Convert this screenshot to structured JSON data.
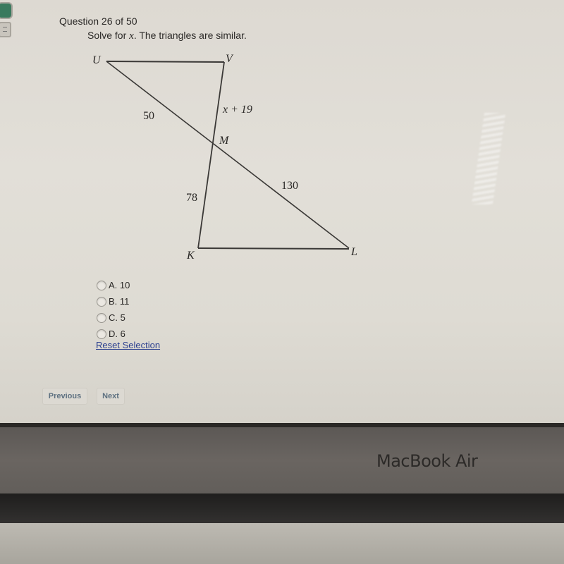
{
  "question": {
    "header": "Question 26 of 50",
    "prompt_before": "Solve for ",
    "prompt_var": "x",
    "prompt_after": ". The triangles are similar."
  },
  "figure": {
    "vertices": {
      "U": "U",
      "V": "V",
      "M": "M",
      "K": "K",
      "L": "L"
    },
    "side_labels": {
      "UM": "50",
      "VM": "x + 19",
      "KM": "78",
      "ML": "130"
    }
  },
  "choices": [
    {
      "letter": "A.",
      "value": "10",
      "selected": false
    },
    {
      "letter": "B.",
      "value": "11",
      "selected": false
    },
    {
      "letter": "C.",
      "value": "5",
      "selected": false
    },
    {
      "letter": "D.",
      "value": "6",
      "selected": false
    }
  ],
  "reset_label": "Reset Selection",
  "nav": {
    "previous": "Previous",
    "next": "Next"
  },
  "device": {
    "brand": "MacBook Air"
  }
}
